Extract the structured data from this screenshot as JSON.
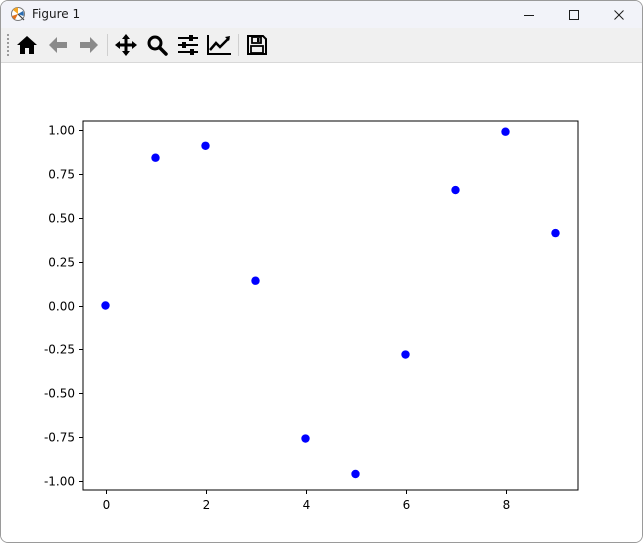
{
  "window": {
    "title": "Figure 1"
  },
  "toolbar": {
    "buttons": [
      {
        "icon": "home-icon"
      },
      {
        "icon": "back-arrow-icon"
      },
      {
        "icon": "forward-arrow-icon"
      },
      {
        "icon": "pan-move-icon"
      },
      {
        "icon": "zoom-magnifier-icon"
      },
      {
        "icon": "configure-subplots-icon"
      },
      {
        "icon": "edit-axis-icon"
      },
      {
        "icon": "save-floppy-icon"
      }
    ]
  },
  "colors": {
    "marker": "#0000ff",
    "axes": "#000000",
    "titlebar": "#f2f3f9",
    "toolbar": "#f0f0f0"
  },
  "chart_data": {
    "type": "scatter",
    "x": [
      0,
      1,
      2,
      3,
      4,
      5,
      6,
      7,
      8,
      9
    ],
    "y": [
      0.0,
      0.841,
      0.909,
      0.141,
      -0.757,
      -0.959,
      -0.279,
      0.657,
      0.989,
      0.412
    ],
    "marker": "o",
    "color": "blue",
    "xlim": [
      -0.45,
      9.45
    ],
    "ylim": [
      -1.05,
      1.05
    ],
    "xticks": [
      "0",
      "2",
      "4",
      "6",
      "8"
    ],
    "yticks": [
      "1.00",
      "0.75",
      "0.50",
      "0.25",
      "0.00",
      "-0.25",
      "-0.50",
      "-0.75",
      "-1.00"
    ],
    "grid": false,
    "title": "",
    "xlabel": "",
    "ylabel": ""
  }
}
